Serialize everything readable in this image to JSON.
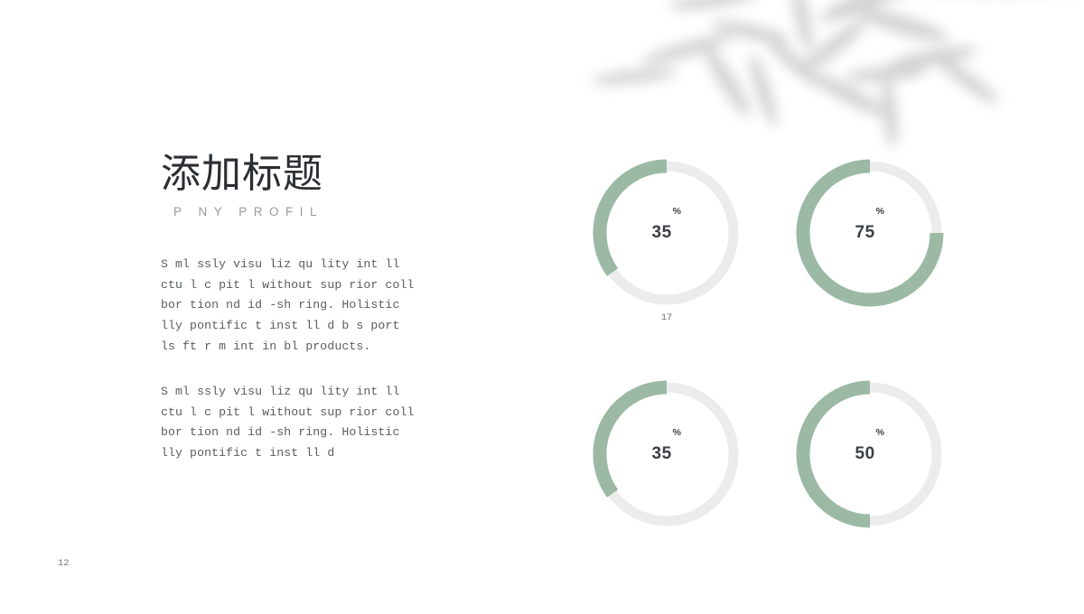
{
  "slide": {
    "background_color": "#ffffff",
    "page_number": "12"
  },
  "header": {
    "title": "添加标题",
    "subtitle": "P  NY   PROFIL"
  },
  "body": {
    "paragraph_1": "S  ml ssly visu liz  qu lity int ll\nctu l c pit l without sup rior coll\nbor tion  nd id  -sh ring. Holistic\nlly pontific t  inst ll d b s  port\nls  ft r m int in bl  products.",
    "paragraph_2": "S  ml ssly visu liz  qu lity int ll\nctu l c pit l without sup rior coll\nbor tion  nd id  -sh ring. Holistic\nlly pontific t  inst ll d"
  },
  "donut_caption": "17",
  "colors": {
    "accent_green": "#9cb9a5",
    "track_gray": "#ececec",
    "title_text": "#2b2f33",
    "subtitle_text": "#9a9a9a",
    "body_text": "#595d61",
    "value_text": "#3a3f44"
  },
  "chart_data": {
    "type": "pie",
    "title": "",
    "subtype": "donut-gauge-set",
    "legend": "none",
    "grid": false,
    "unit": "%",
    "max_value": 100,
    "series": [
      {
        "name": "donut-1",
        "value": 35,
        "label": "35",
        "suffix": "%",
        "start_angle_deg": 270,
        "sweep_deg": -126,
        "direction": "counterclockwise",
        "color": "#9cb9a5",
        "track_color": "#ececec"
      },
      {
        "name": "donut-2",
        "value": 75,
        "label": "75",
        "suffix": "%",
        "start_angle_deg": 270,
        "sweep_deg": -270,
        "direction": "counterclockwise",
        "color": "#9cb9a5",
        "track_color": "#ececec"
      },
      {
        "name": "donut-3",
        "value": 35,
        "label": "35",
        "suffix": "%",
        "start_angle_deg": 270,
        "sweep_deg": -126,
        "direction": "counterclockwise",
        "color": "#9cb9a5",
        "track_color": "#ececec"
      },
      {
        "name": "donut-4",
        "value": 50,
        "label": "50",
        "suffix": "%",
        "start_angle_deg": 270,
        "sweep_deg": -180,
        "direction": "counterclockwise",
        "color": "#9cb9a5",
        "track_color": "#ececec"
      }
    ],
    "categories": [
      "35%",
      "75%",
      "35%",
      "50%"
    ],
    "values": [
      35,
      75,
      35,
      50
    ]
  }
}
